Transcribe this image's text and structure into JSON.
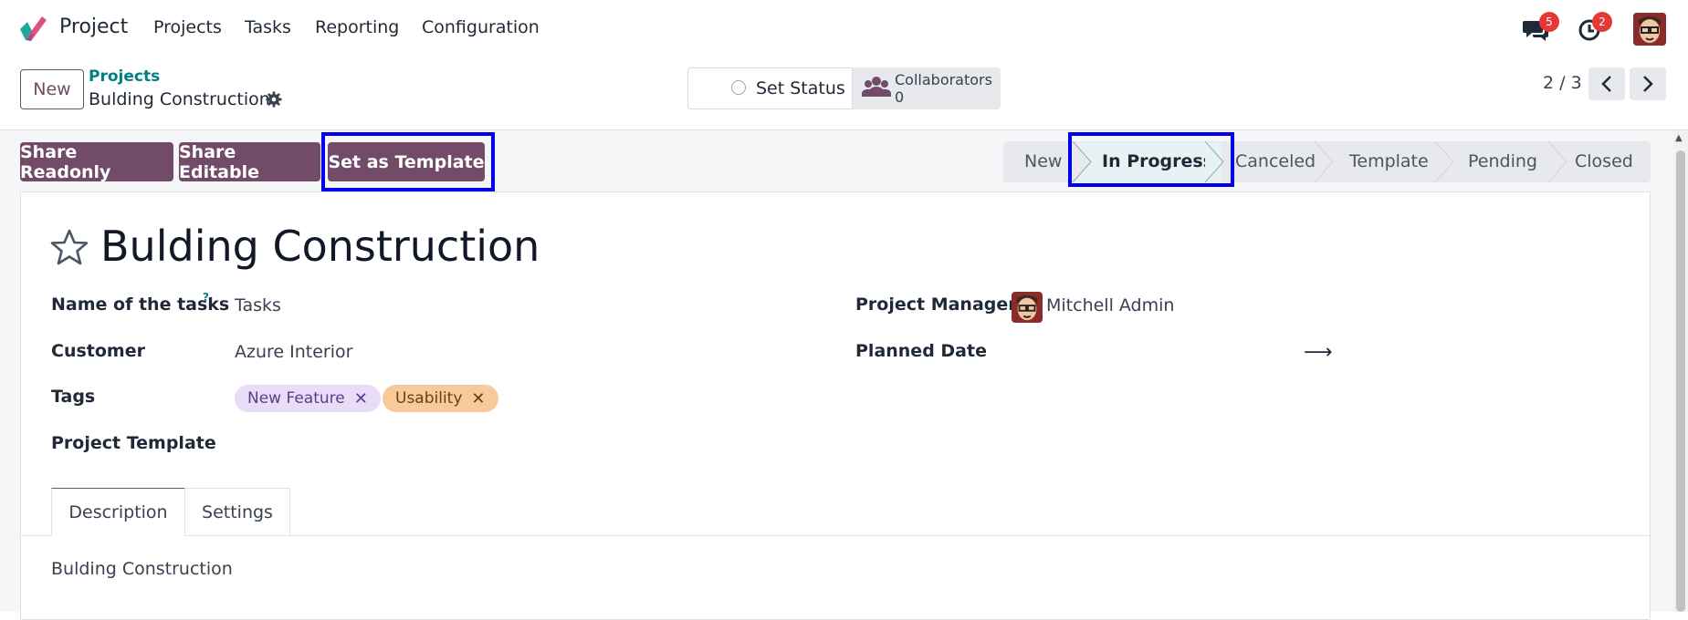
{
  "navbar": {
    "app_name": "Project",
    "menus": [
      "Projects",
      "Tasks",
      "Reporting",
      "Configuration"
    ],
    "messages_count": "5",
    "activities_count": "2"
  },
  "control_panel": {
    "new_label": "New",
    "breadcrumb_parent": "Projects",
    "breadcrumb_current": "Bulding Construction",
    "status_label": "Set Status",
    "collaborators_label": "Collaborators",
    "collaborators_count": "0",
    "pager": "2 / 3"
  },
  "actions": {
    "share_readonly": "Share Readonly",
    "share_editable": "Share Editable",
    "set_as_template": "Set as Template"
  },
  "stages": {
    "items": [
      "New",
      "In Progress",
      "Canceled",
      "Template",
      "Pending",
      "Closed"
    ],
    "active": "In Progress"
  },
  "form": {
    "title": "Bulding Construction",
    "name_of_tasks_label": "Name of the tasks",
    "help_marker": "?",
    "name_of_tasks_value": "Tasks",
    "customer_label": "Customer",
    "customer_value": "Azure Interior",
    "tags_label": "Tags",
    "tags": [
      "New Feature",
      "Usability"
    ],
    "project_template_label": "Project Template",
    "project_manager_label": "Project Manager",
    "project_manager_value": "Mitchell Admin",
    "planned_date_label": "Planned Date",
    "planned_date_arrow": "⟶"
  },
  "tabs": {
    "description": "Description",
    "settings": "Settings",
    "description_content": "Bulding Construction"
  },
  "colors": {
    "primary": "#714b67",
    "link": "#017e84",
    "badge": "#e53935",
    "highlight": "#0000ee",
    "tag_new_feature_bg": "#e8dcf7",
    "tag_usability_bg": "#f8c99a"
  }
}
